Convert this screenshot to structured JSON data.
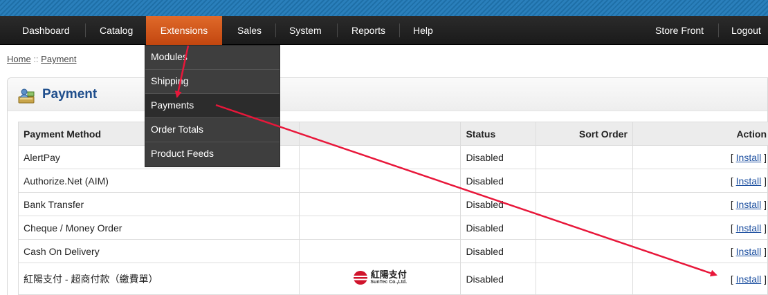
{
  "nav": {
    "items": [
      "Dashboard",
      "Catalog",
      "Extensions",
      "Sales",
      "System",
      "Reports",
      "Help"
    ],
    "active": "Extensions",
    "right": [
      "Store Front",
      "Logout"
    ]
  },
  "dropdown": {
    "items": [
      "Modules",
      "Shipping",
      "Payments",
      "Order Totals",
      "Product Feeds"
    ],
    "highlighted": "Payments"
  },
  "breadcrumb": {
    "home": "Home",
    "separator": "::",
    "current": "Payment"
  },
  "panel": {
    "title": "Payment",
    "icon": "payment-icon"
  },
  "table": {
    "headers": [
      "Payment Method",
      "",
      "Status",
      "Sort Order",
      "Action"
    ],
    "rows": [
      {
        "method": "AlertPay",
        "status": "Disabled",
        "sort": "",
        "action": "Install"
      },
      {
        "method": "Authorize.Net (AIM)",
        "status": "Disabled",
        "sort": "",
        "action": "Install"
      },
      {
        "method": "Bank Transfer",
        "status": "Disabled",
        "sort": "",
        "action": "Install"
      },
      {
        "method": "Cheque / Money Order",
        "status": "Disabled",
        "sort": "",
        "action": "Install"
      },
      {
        "method": "Cash On Delivery",
        "status": "Disabled",
        "sort": "",
        "action": "Install"
      },
      {
        "method": "紅陽支付 - 超商付款（繳費單）",
        "status": "Disabled",
        "sort": "",
        "action": "Install",
        "logo": {
          "main": "紅陽支付",
          "sub": "SunTec Co.,Ltd."
        }
      }
    ],
    "bracket_open": "[",
    "bracket_close": "]"
  },
  "colors": {
    "active_tab": "#d4561c",
    "title": "#1f4e8c",
    "annotation": "#e8173a",
    "link": "#1c4fa0"
  }
}
